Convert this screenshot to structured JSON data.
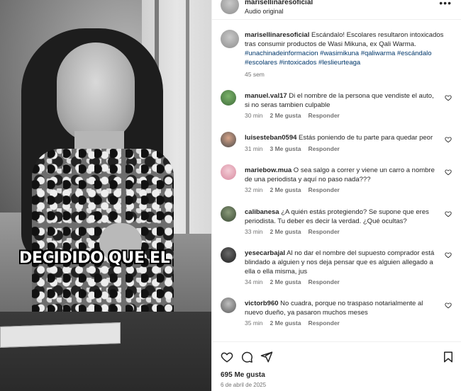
{
  "video": {
    "caption_overlay": "DECIDIDO QUE EL"
  },
  "header": {
    "username": "marisellinaresoficial",
    "audio_label": "Audio original",
    "more_label": "•••"
  },
  "post_caption": {
    "username": "marisellinaresoficial",
    "text": " Escándalo! Escolares resultaron intoxicados tras consumir productos de Wasi Mikuna, ex Qali Warma. ",
    "hashtags": "#unachinadeinformacion #wasimikuna #qaliwarma #escándalo #escolares #intoxicados #leslieurteaga",
    "time": "45 sem"
  },
  "comments": [
    {
      "username": "manuel.val17",
      "text": " Di el nombre de la persona que vendiste el auto, si no seras tambien culpable",
      "time": "30 min",
      "likes": "2 Me gusta",
      "reply": "Responder"
    },
    {
      "username": "luisesteban0594",
      "text": " Estás poniendo de tu parte para quedar peor",
      "time": "31 min",
      "likes": "3 Me gusta",
      "reply": "Responder"
    },
    {
      "username": "mariebow.mua",
      "text": " O sea salgo a correr y viene un carro a nombre de una periodista y aquí no paso nada???",
      "time": "32 min",
      "likes": "2 Me gusta",
      "reply": "Responder"
    },
    {
      "username": "calibanesa",
      "text": " ¿A quién estás protegiendo? Se supone que eres periodista. Tu deber es decir la verdad. ¿Qué ocultas?",
      "time": "33 min",
      "likes": "2 Me gusta",
      "reply": "Responder"
    },
    {
      "username": "yesecarbajal",
      "text": " Al no dar el nombre del supuesto comprador está blindado a alguien y nos deja pensar que es alguien allegado a ella o ella misma, jus",
      "time": "34 min",
      "likes": "2 Me gusta",
      "reply": "Responder"
    },
    {
      "username": "victorb960",
      "text": " No cuadra, porque no traspaso notarialmente al nuevo dueño, ya pasaron muchos meses",
      "time": "35 min",
      "likes": "2 Me gusta",
      "reply": "Responder"
    }
  ],
  "footer": {
    "likes": "695 Me gusta",
    "date": "6 de abril de 2025"
  },
  "colors": {
    "text": "#262626",
    "muted": "#737373",
    "hashtag": "#00376b",
    "border": "#efefef"
  },
  "icons": [
    "heart-icon",
    "comment-icon",
    "share-icon",
    "bookmark-icon",
    "more-icon"
  ]
}
